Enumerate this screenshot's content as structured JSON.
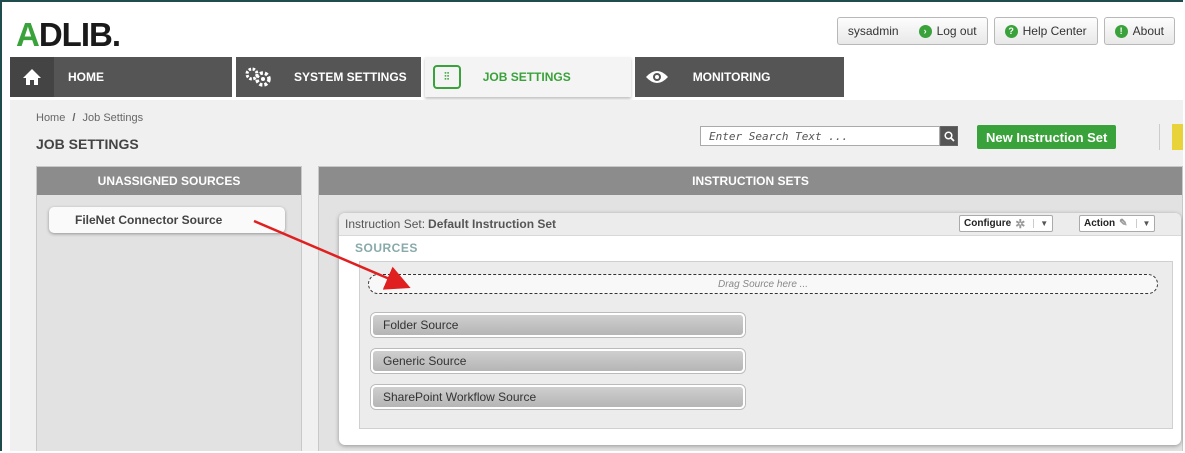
{
  "header": {
    "logo": "ADLIB.",
    "user": "sysadmin",
    "logout": "Log out",
    "help": "Help Center",
    "about": "About"
  },
  "nav": {
    "home": "HOME",
    "system_settings": "SYSTEM SETTINGS",
    "job_settings": "JOB SETTINGS",
    "monitoring": "MONITORING"
  },
  "page": {
    "breadcrumb_home": "Home",
    "breadcrumb_sep": "/",
    "breadcrumb_current": "Job Settings",
    "title": "JOB SETTINGS",
    "search_placeholder": "Enter Search Text ...",
    "new_button": "New Instruction Set"
  },
  "left_panel": {
    "title": "UNASSIGNED SOURCES",
    "sources": [
      "FileNet Connector Source"
    ]
  },
  "right_panel": {
    "title": "INSTRUCTION SETS",
    "instruction_set": {
      "label": "Instruction Set:",
      "name": "Default Instruction Set",
      "configure": "Configure",
      "action": "Action",
      "sources_label": "SOURCES",
      "drop_hint": "Drag Source here ...",
      "sources": [
        "Folder Source",
        "Generic Source",
        "SharePoint Workflow Source"
      ]
    }
  },
  "colors": {
    "accent": "#3aa23a",
    "nav_bg": "#555555",
    "arrow": "#e02020"
  }
}
